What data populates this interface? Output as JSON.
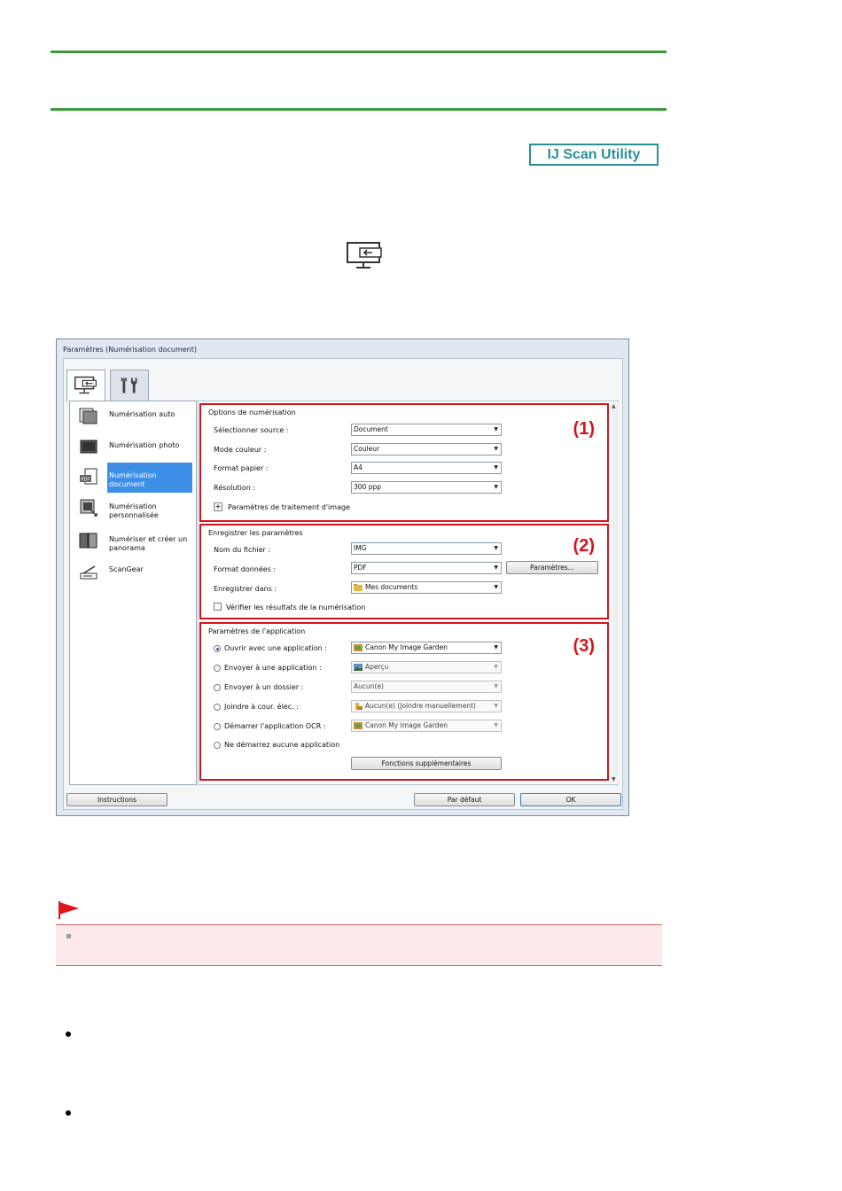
{
  "logo": {
    "label": "IJ Scan Utility"
  },
  "dialog": {
    "title": "Paramètres (Numérisation document)",
    "tabs": [
      {
        "icon": "scan-from-computer-icon",
        "selected": true
      },
      {
        "icon": "tools-icon",
        "selected": false
      }
    ],
    "sidebar": {
      "items": [
        {
          "label": "Numérisation auto",
          "icon": "auto-scan-icon",
          "selected": false
        },
        {
          "label": "Numérisation photo",
          "icon": "photo-scan-icon",
          "selected": false
        },
        {
          "label": "Numérisation document",
          "icon": "document-scan-icon",
          "selected": true
        },
        {
          "label": "Numérisation personnalisée",
          "icon": "custom-scan-icon",
          "selected": false
        },
        {
          "label": "Numériser et créer un panorama",
          "icon": "panorama-icon",
          "selected": false
        },
        {
          "label": "ScanGear",
          "icon": "scangear-icon",
          "selected": false
        }
      ]
    },
    "scan_options": {
      "legend": "Options de numérisation",
      "number": "(1)",
      "source_label": "Sélectionner source :",
      "source_value": "Document",
      "color_label": "Mode couleur :",
      "color_value": "Couleur",
      "paper_label": "Format papier :",
      "paper_value": "A4",
      "resolution_label": "Résolution :",
      "resolution_value": "300 ppp",
      "image_processing_label": "Paramètres de traitement d'image",
      "expand_symbol": "+"
    },
    "save_settings": {
      "legend": "Enregistrer les paramètres",
      "number": "(2)",
      "filename_label": "Nom du fichier :",
      "filename_value": "IMG",
      "format_label": "Format données :",
      "format_value": "PDF",
      "format_settings_button": "Paramètres...",
      "save_in_label": "Enregistrer dans :",
      "save_in_value": "Mes documents",
      "verify_label": "Vérifier les résultats de la numérisation"
    },
    "app_settings": {
      "legend": "Paramètres de l'application",
      "number": "(3)",
      "options": [
        {
          "label": "Ouvrir avec une application :",
          "value": "Canon My Image Garden",
          "checked": true,
          "enabled": true,
          "icon": "image-garden-icon"
        },
        {
          "label": "Envoyer à une application :",
          "value": "Aperçu",
          "checked": false,
          "enabled": false,
          "icon": "preview-icon"
        },
        {
          "label": "Envoyer à un dossier :",
          "value": "Aucun(e)",
          "checked": false,
          "enabled": false,
          "icon": ""
        },
        {
          "label": "Joindre à cour. élec. :",
          "value": "Aucun(e) (Joindre manuellement)",
          "checked": false,
          "enabled": false,
          "icon": "mail-icon"
        },
        {
          "label": "Démarrer l'application OCR :",
          "value": "Canon My Image Garden",
          "checked": false,
          "enabled": false,
          "icon": "image-garden-icon"
        },
        {
          "label": "Ne démarrez aucune application",
          "checked": false
        }
      ],
      "more_functions_button": "Fonctions supplémentaires"
    },
    "footer": {
      "instructions_button": "Instructions",
      "defaults_button": "Par défaut",
      "ok_button": "OK"
    }
  },
  "colors": {
    "rule_green": "#3c9a3c",
    "logo_teal": "#2a8f98",
    "highlight_red": "#d6141c",
    "selection_blue": "#3d8ee6",
    "important_bg": "#fde9e9"
  }
}
